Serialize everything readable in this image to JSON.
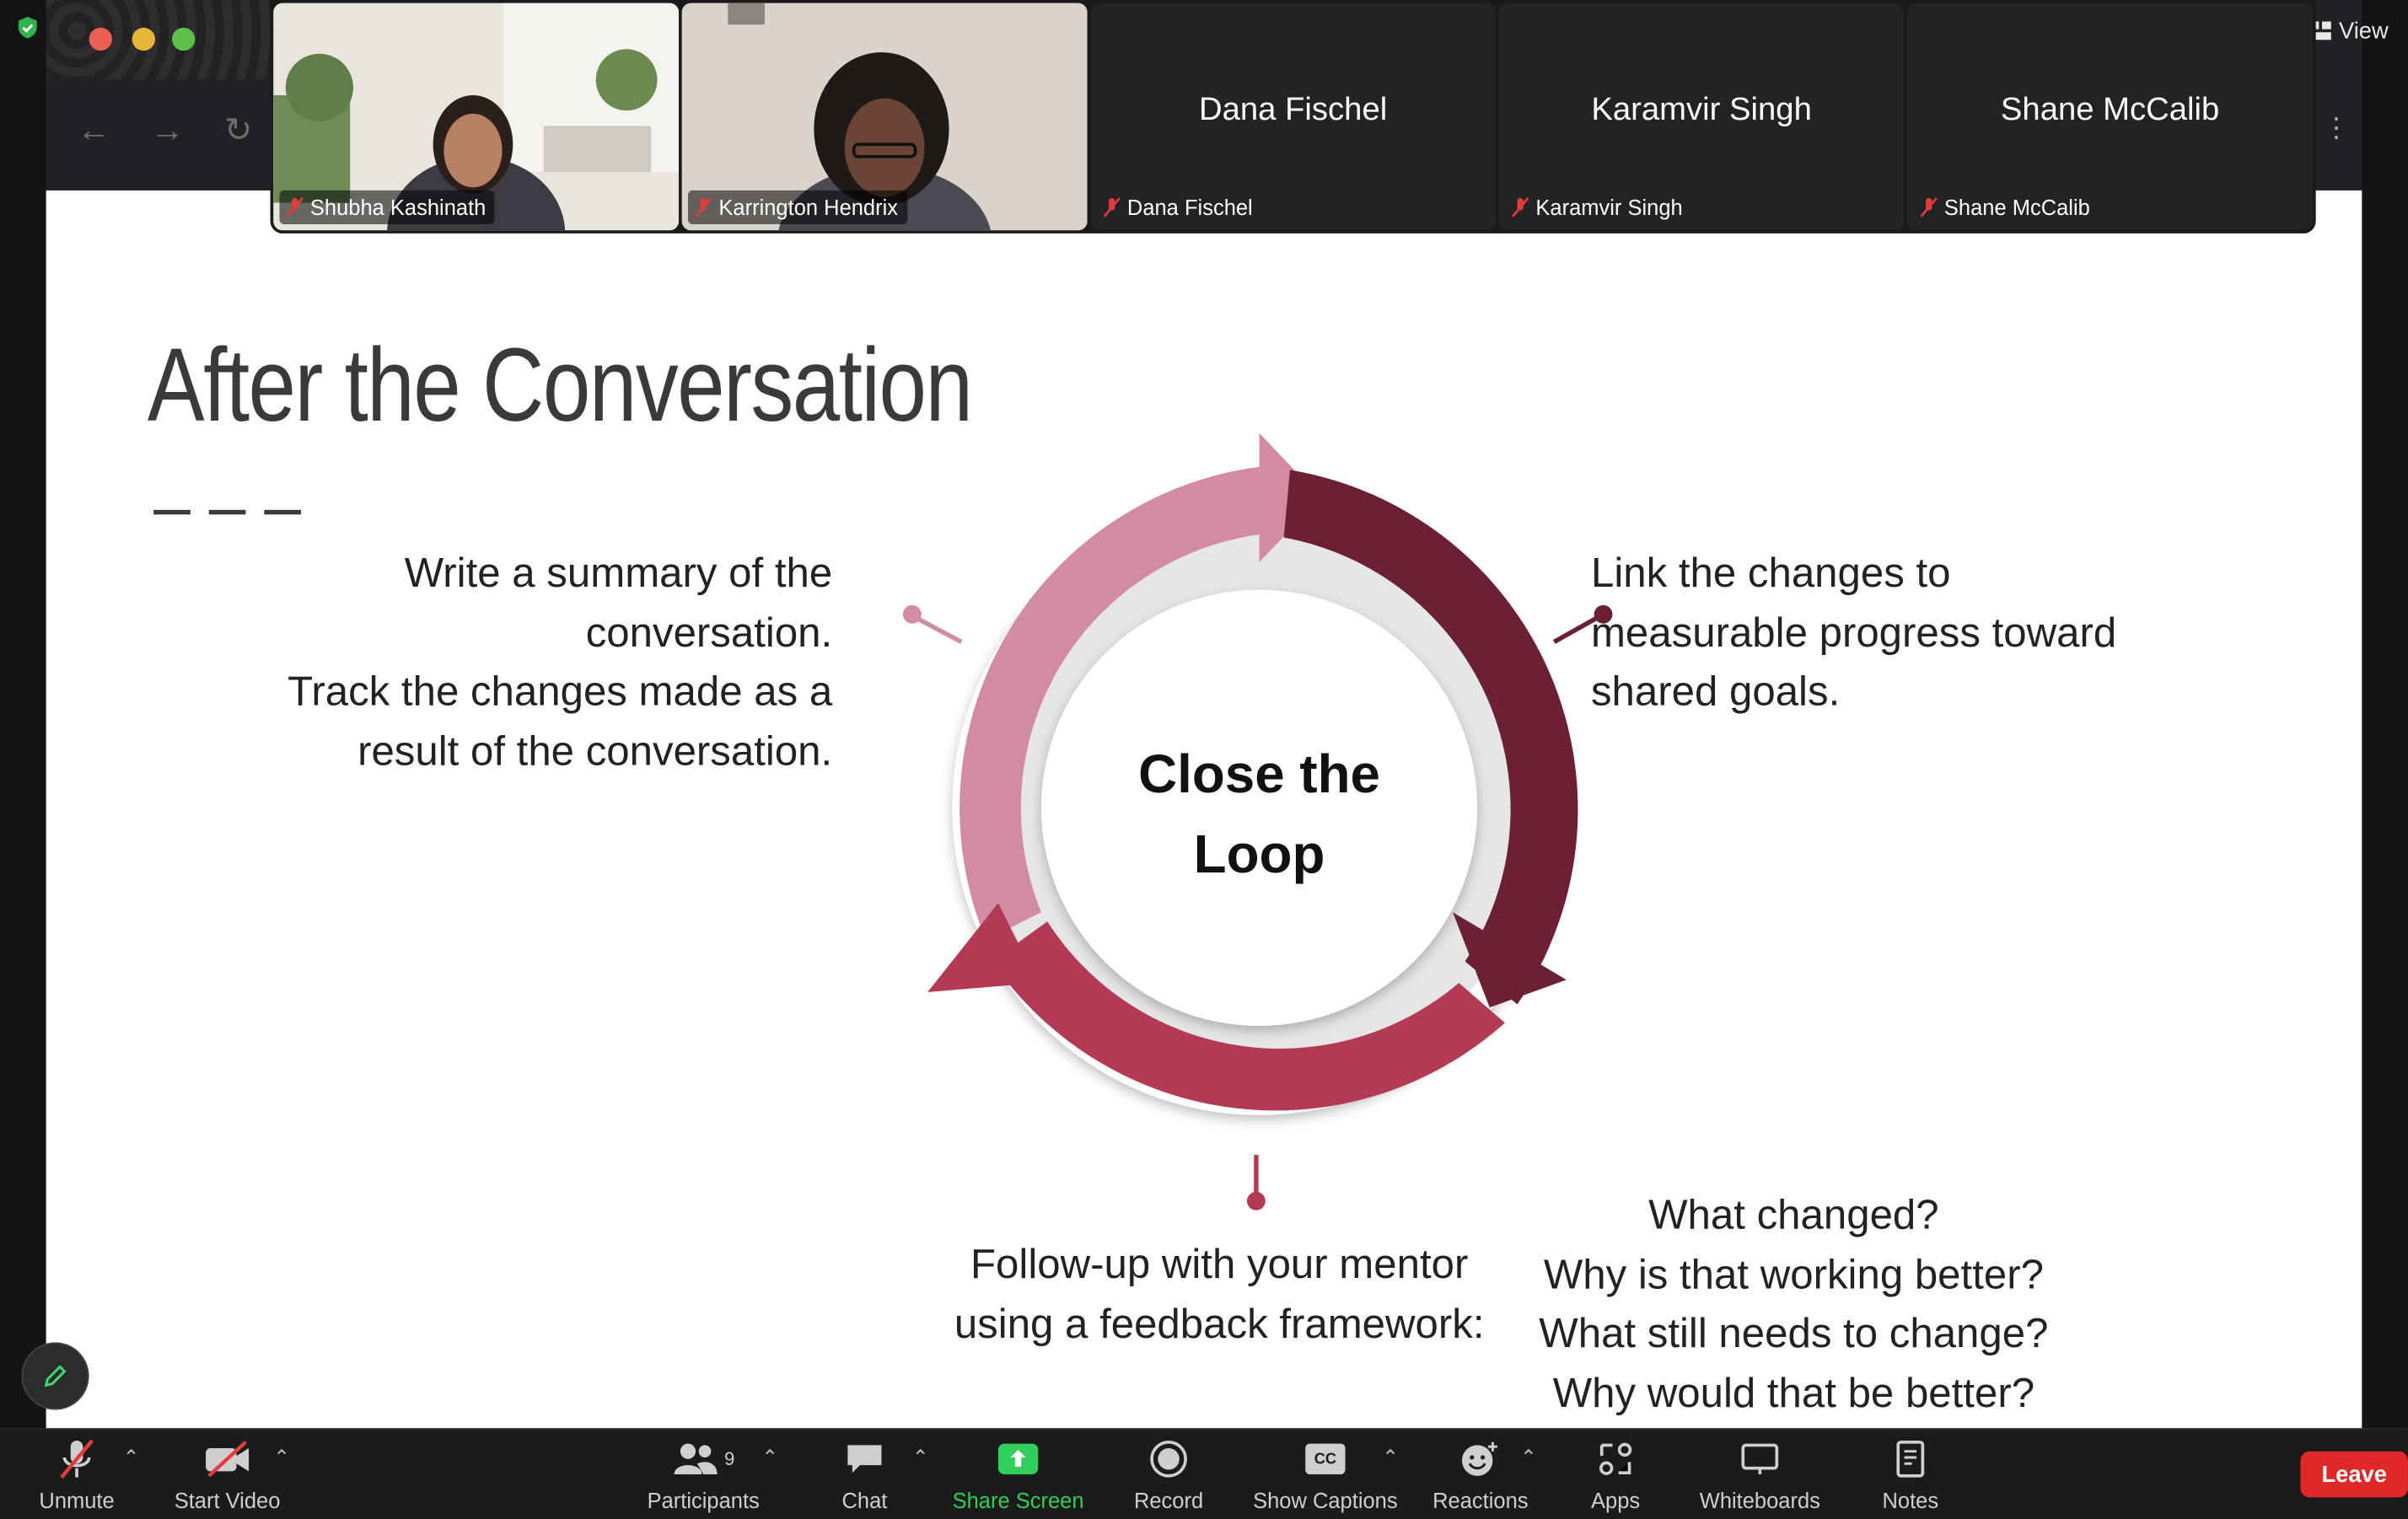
{
  "window": {
    "view_label": "View"
  },
  "participants": [
    {
      "name": "Shubha Kashinath",
      "video": true
    },
    {
      "name": "Karrington Hendrix",
      "video": true
    },
    {
      "name": "Dana Fischel",
      "video": false
    },
    {
      "name": "Karamvir Singh",
      "video": false
    },
    {
      "name": "Shane McCalib",
      "video": false
    }
  ],
  "slide": {
    "title": "After the Conversation",
    "center_line1": "Close the",
    "center_line2": "Loop",
    "left_note": [
      "Write a summary of the",
      "conversation.",
      "Track the changes made as a",
      "result of the conversation."
    ],
    "right_note": [
      "Link the changes to",
      "measurable progress toward",
      "shared goals."
    ],
    "bottom_note": [
      "Follow-up with your mentor",
      "using a feedback framework:"
    ],
    "questions": [
      "What changed?",
      "Why is that working better?",
      "What still needs to change?",
      "Why would that be better?"
    ],
    "colors": {
      "pink": "#d38aa3",
      "dark": "#6b2034",
      "red": "#b33a55",
      "ring": "#e6e6e6"
    }
  },
  "toolbar": {
    "unmute": "Unmute",
    "start_video": "Start Video",
    "participants": "Participants",
    "participant_count": "9",
    "chat": "Chat",
    "share_screen": "Share Screen",
    "record": "Record",
    "show_captions": "Show Captions",
    "reactions": "Reactions",
    "apps": "Apps",
    "whiteboards": "Whiteboards",
    "notes": "Notes",
    "leave": "Leave",
    "cc_icon_text": "CC"
  }
}
